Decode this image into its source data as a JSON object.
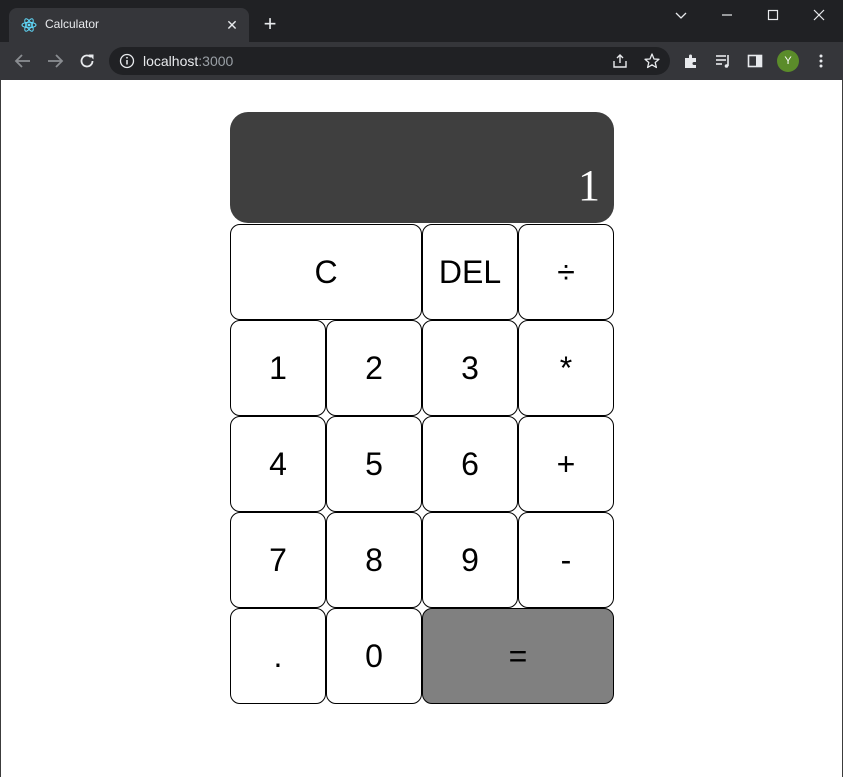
{
  "browser": {
    "tab_title": "Calculator",
    "tab_close": "✕",
    "new_tab": "+",
    "url_host": "localhost",
    "url_port": ":3000",
    "profile_initial": "Y"
  },
  "calculator": {
    "display_value": "1",
    "keys": {
      "clear": "C",
      "delete": "DEL",
      "divide": "÷",
      "one": "1",
      "two": "2",
      "three": "3",
      "multiply": "*",
      "four": "4",
      "five": "5",
      "six": "6",
      "add": "+",
      "seven": "7",
      "eight": "8",
      "nine": "9",
      "subtract": "-",
      "decimal": ".",
      "zero": "0",
      "equals": "="
    }
  },
  "colors": {
    "display_bg": "#3f3f3f",
    "equals_bg": "#808080",
    "key_bg": "#ffffff"
  }
}
